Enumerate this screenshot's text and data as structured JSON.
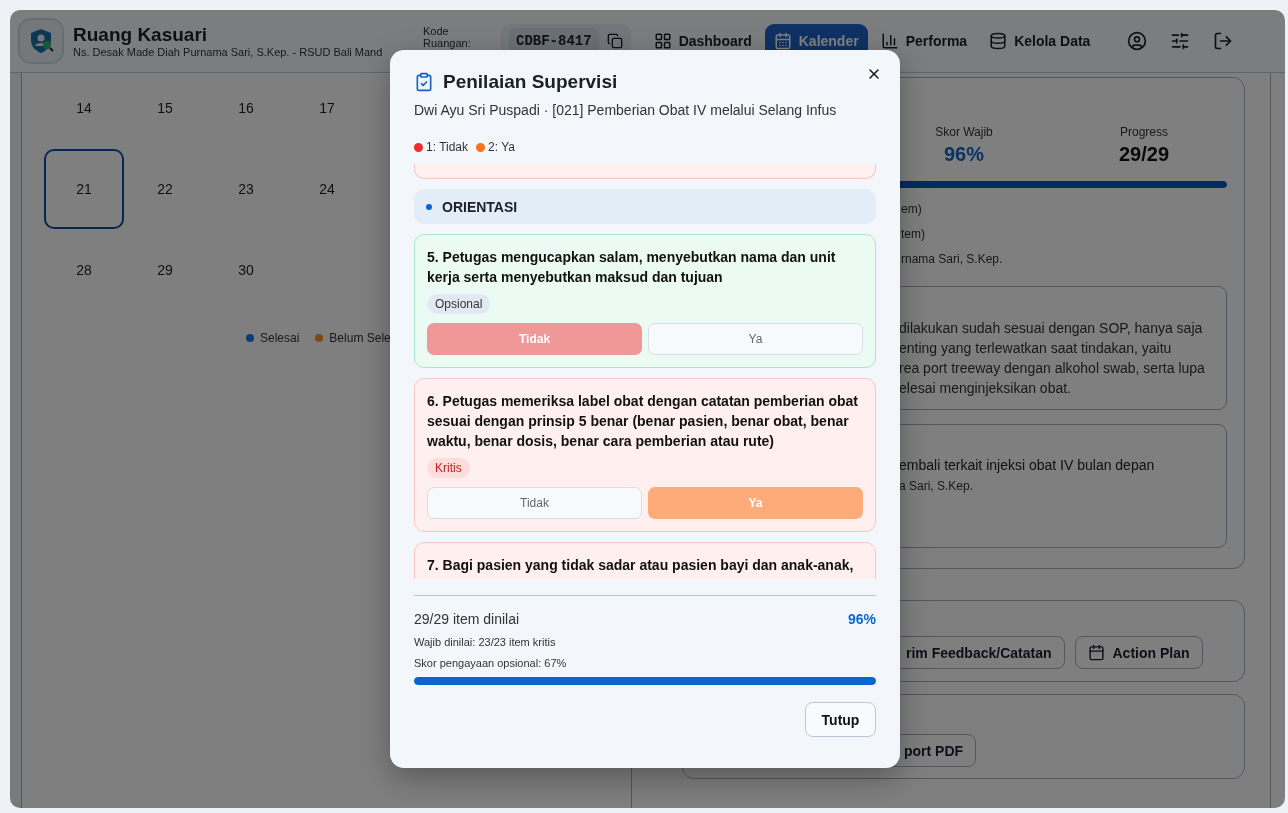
{
  "header": {
    "title": "Ruang Kasuari",
    "subtitle": "Ns. Desak Made Diah Purnama Sari, S.Kep. - RSUD Bali Mand",
    "room_label": "Kode Ruangan:",
    "room_code": "CDBF-8417"
  },
  "nav": [
    {
      "label": "Dashboard",
      "selected": false
    },
    {
      "label": "Kalender",
      "selected": true
    },
    {
      "label": "Performa",
      "selected": false
    },
    {
      "label": "Kelola Data",
      "selected": false
    }
  ],
  "calendar": {
    "weeks": [
      [
        {
          "label": "14",
          "selected": false
        },
        {
          "label": "15",
          "selected": false
        },
        {
          "label": "16",
          "selected": false
        },
        {
          "label": "17",
          "selected": false
        }
      ],
      [
        {
          "label": "21",
          "selected": true
        },
        {
          "label": "22",
          "selected": false
        },
        {
          "label": "23",
          "selected": false
        },
        {
          "label": "24",
          "selected": false
        }
      ],
      [
        {
          "label": "28",
          "selected": false
        },
        {
          "label": "29",
          "selected": false
        },
        {
          "label": "30",
          "selected": false
        }
      ]
    ],
    "legend": [
      {
        "label": "Selesai",
        "color": "#0b3d7a"
      },
      {
        "label": "Belum Sele",
        "color": "#7a4d0e"
      }
    ]
  },
  "summary": {
    "stats": [
      {
        "label": "Skor Wajib",
        "value": "96%",
        "kind": "accent"
      },
      {
        "label": "Progress",
        "value": "29/29",
        "kind": "plain"
      }
    ],
    "level": 1,
    "lines": [
      "em)",
      "tem)",
      "rnama Sari, S.Kep."
    ],
    "note_lines": [
      "dilakukan sudah sesuai dengan SOP, hanya saja",
      "enting yang terlewatkan saat tindakan, yaitu",
      "rea port treeway dengan alkohol swab, serta lupa",
      "elesai menginjeksikan obat."
    ],
    "plan_text": "embali terkait injeksi obat IV bulan depan",
    "plan_author": "a Sari, S.Kep."
  },
  "actions": [
    "rim Feedback/Catatan",
    "Action Plan"
  ],
  "export": [
    "port PDF"
  ],
  "modal": {
    "title": "Penilaian Supervisi",
    "subtitle": "Dwi Ayu Sri Puspadi · [021] Pemberian Obat IV melalui Selang Infus",
    "legend": [
      {
        "label": "1: Tidak",
        "color": "#ef2b2d"
      },
      {
        "label": "2: Ya",
        "color": "#f97316"
      }
    ],
    "section": "ORIENTASI",
    "items": [
      {
        "text": "5. Petugas mengucapkan salam, menyebutkan nama dan unit kerja serta menyebutkan maksud dan tujuan",
        "kind": "optional",
        "tag": "Opsional",
        "options": [
          {
            "label": "Tidak",
            "kind": "no",
            "selected": true
          },
          {
            "label": "Ya",
            "kind": "yes",
            "selected": false
          }
        ]
      },
      {
        "text": "6. Petugas memeriksa label obat dengan catatan pemberian obat sesuai dengan prinsip 5 benar (benar pasien, benar obat, benar waktu, benar dosis, benar cara pemberian atau rute)",
        "kind": "critical",
        "tag": "Kritis",
        "options": [
          {
            "label": "Tidak",
            "kind": "no",
            "selected": false
          },
          {
            "label": "Ya",
            "kind": "yes",
            "selected": true
          }
        ]
      },
      {
        "text": "7. Bagi pasien yang tidak sadar atau pasien bayi dan anak-anak,",
        "kind": "critical"
      }
    ],
    "footer": {
      "count": "29/29 item dinilai",
      "score": "96%",
      "required": "Wajib dinilai: 23/23 item kritis",
      "optional": "Skor pengayaan opsional: 67%",
      "level": 1,
      "close": "Tutup"
    }
  }
}
